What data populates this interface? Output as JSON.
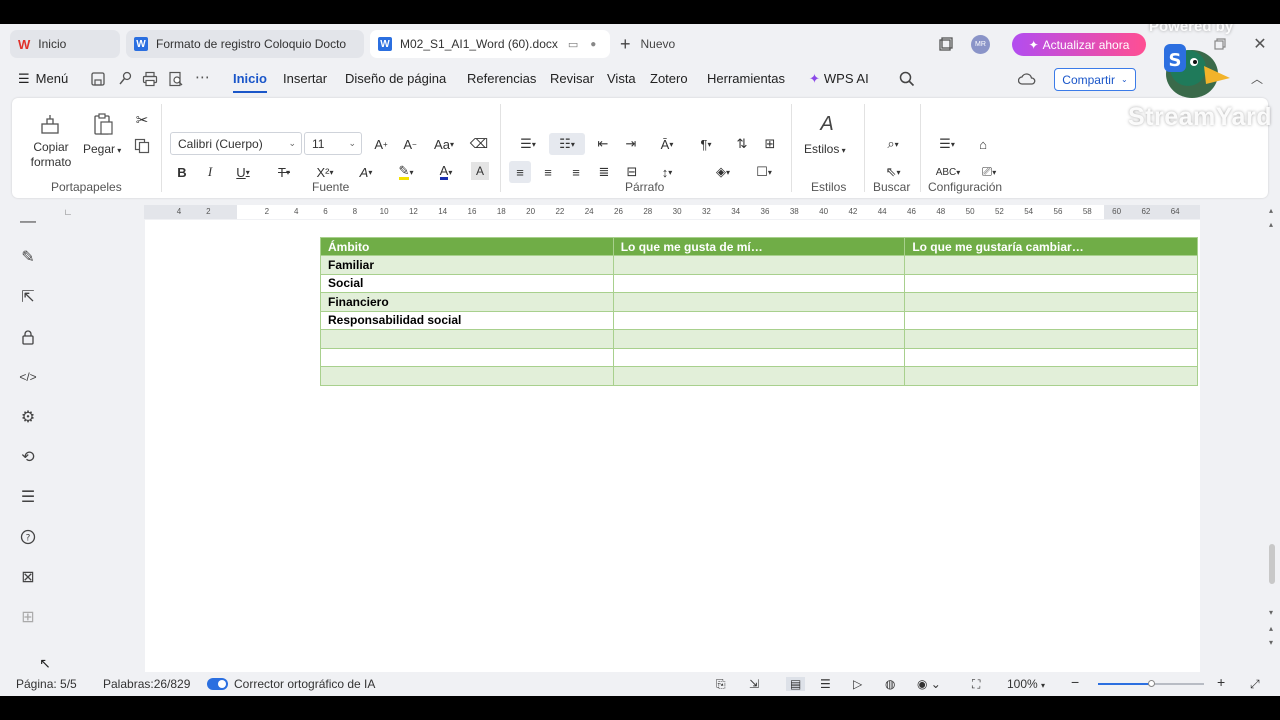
{
  "tabs": [
    {
      "label": "Inicio",
      "icon": "W"
    },
    {
      "label": "Formato de registro Coloquio Docto",
      "icon": "W"
    },
    {
      "label": "M02_S1_AI1_Word (60).docx",
      "icon": "W"
    }
  ],
  "new_tab_label": "Nuevo",
  "avatar_initials": "MR",
  "update_button": "Actualizar ahora",
  "menu": {
    "menu_label": "Menú",
    "items": [
      "Inicio",
      "Insertar",
      "Diseño de página",
      "Referencias",
      "Revisar",
      "Vista",
      "Zotero",
      "Herramientas",
      "WPS AI"
    ],
    "share_label": "Compartir"
  },
  "ribbon": {
    "copy_format": "Copiar formato",
    "copy_format_l1": "Copiar",
    "copy_format_l2": "formato",
    "paste": "Pegar",
    "font_name": "Calibri (Cuerpo)",
    "font_size": "11",
    "styles": "Estilos",
    "groups": [
      "Portapapeles",
      "Fuente",
      "Párrafo",
      "Estilos",
      "Buscar",
      "Configuración"
    ]
  },
  "ruler_numbers": [
    "4",
    "2",
    "2",
    "4",
    "6",
    "8",
    "10",
    "12",
    "14",
    "16",
    "18",
    "20",
    "22",
    "24",
    "26",
    "28",
    "30",
    "32",
    "34",
    "36",
    "38",
    "40",
    "42",
    "44",
    "46",
    "48",
    "50",
    "52",
    "54",
    "56",
    "58",
    "60",
    "62",
    "64"
  ],
  "table": {
    "headers": [
      "Ámbito",
      "Lo que me gusta de mí…",
      "Lo que me gustaría cambiar…"
    ],
    "rows": [
      [
        "Familiar",
        "",
        ""
      ],
      [
        "Social",
        "",
        ""
      ],
      [
        "Financiero",
        "",
        ""
      ],
      [
        "Responsabilidad social",
        "",
        ""
      ],
      [
        "",
        "",
        ""
      ],
      [
        "",
        "",
        ""
      ],
      [
        "",
        "",
        ""
      ]
    ],
    "header_color": "#70ad47",
    "band_color": "#e2efd9"
  },
  "status": {
    "page": "Página: 5/5",
    "words": "Palabras:26/829",
    "spellcheck": "Corrector ortográfico de IA",
    "zoom": "100%"
  },
  "watermark": {
    "powered_by": "Powered by",
    "brand": "StreamYard"
  },
  "colors": {
    "accent": "#1a56c9",
    "update_gradient_start": "#b24df0",
    "update_gradient_end": "#ff4f92"
  }
}
